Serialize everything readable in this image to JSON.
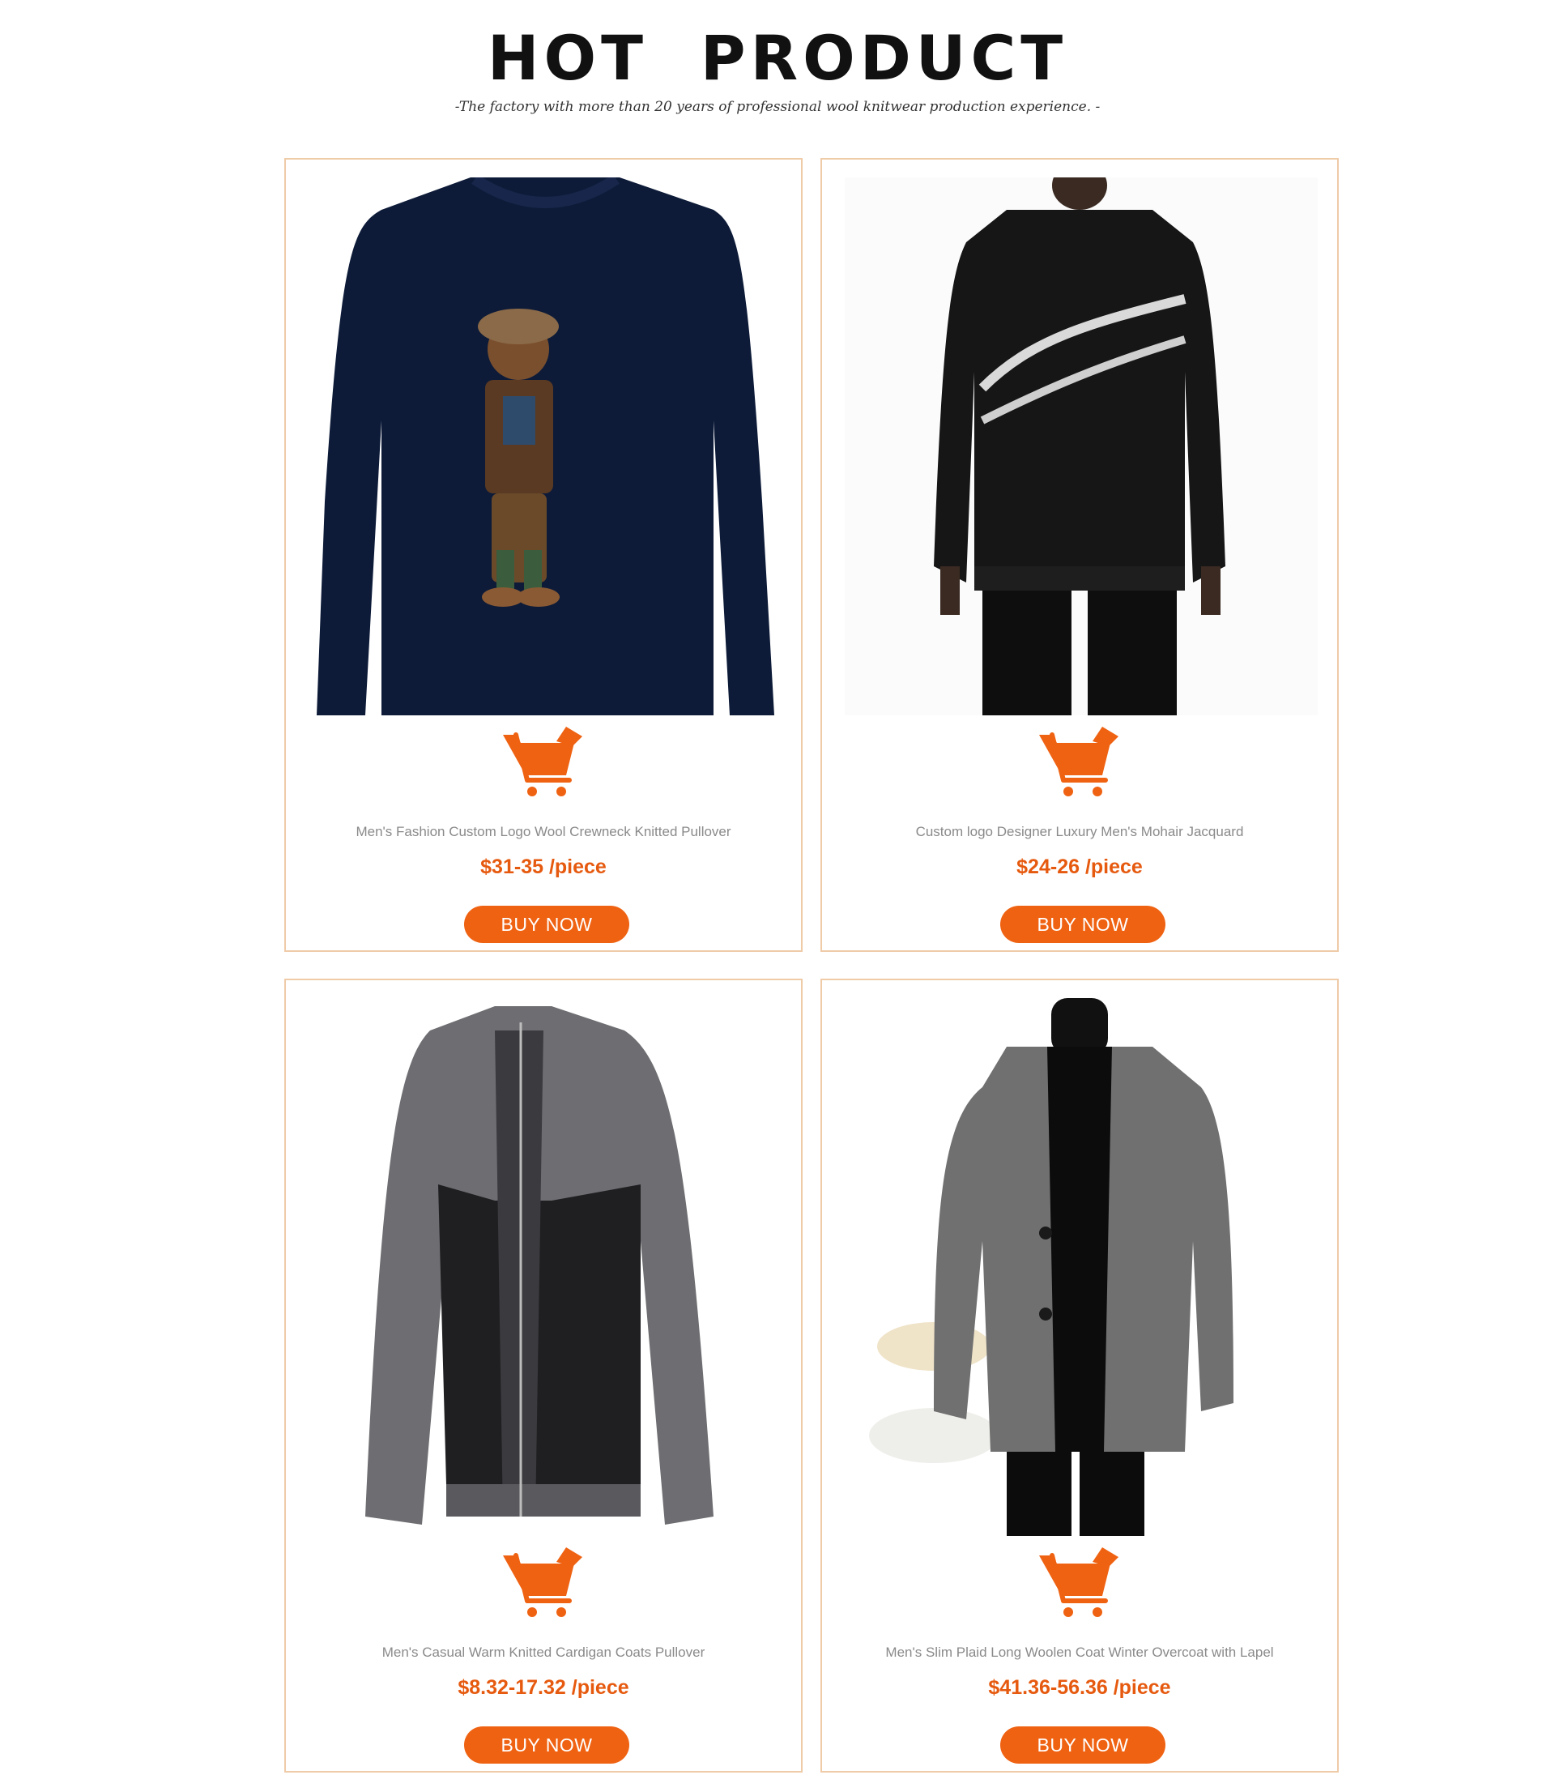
{
  "header": {
    "title": "HOT  PRODUCT",
    "subtitle": "-The factory with more than 20 years of professional wool knitwear production experience. -"
  },
  "theme": {
    "accent": "#ef6212",
    "price_color": "#e65a0f",
    "border": "#efcba8"
  },
  "products": [
    {
      "name": "Men's Fashion Custom Logo Wool Crewneck Knitted Pullover",
      "price": "$31-35 /piece",
      "button": "BUY NOW",
      "icon": "cart-icon"
    },
    {
      "name": "Custom logo Designer Luxury Men's Mohair Jacquard",
      "price": "$24-26 /piece",
      "button": "BUY NOW",
      "icon": "cart-icon"
    },
    {
      "name": "Men's Casual Warm Knitted Cardigan Coats Pullover",
      "price": "$8.32-17.32 /piece",
      "button": "BUY NOW",
      "icon": "cart-icon"
    },
    {
      "name": "Men's Slim Plaid Long Woolen Coat Winter Overcoat with Lapel",
      "price": "$41.36-56.36 /piece",
      "button": "BUY NOW",
      "icon": "cart-icon"
    }
  ]
}
